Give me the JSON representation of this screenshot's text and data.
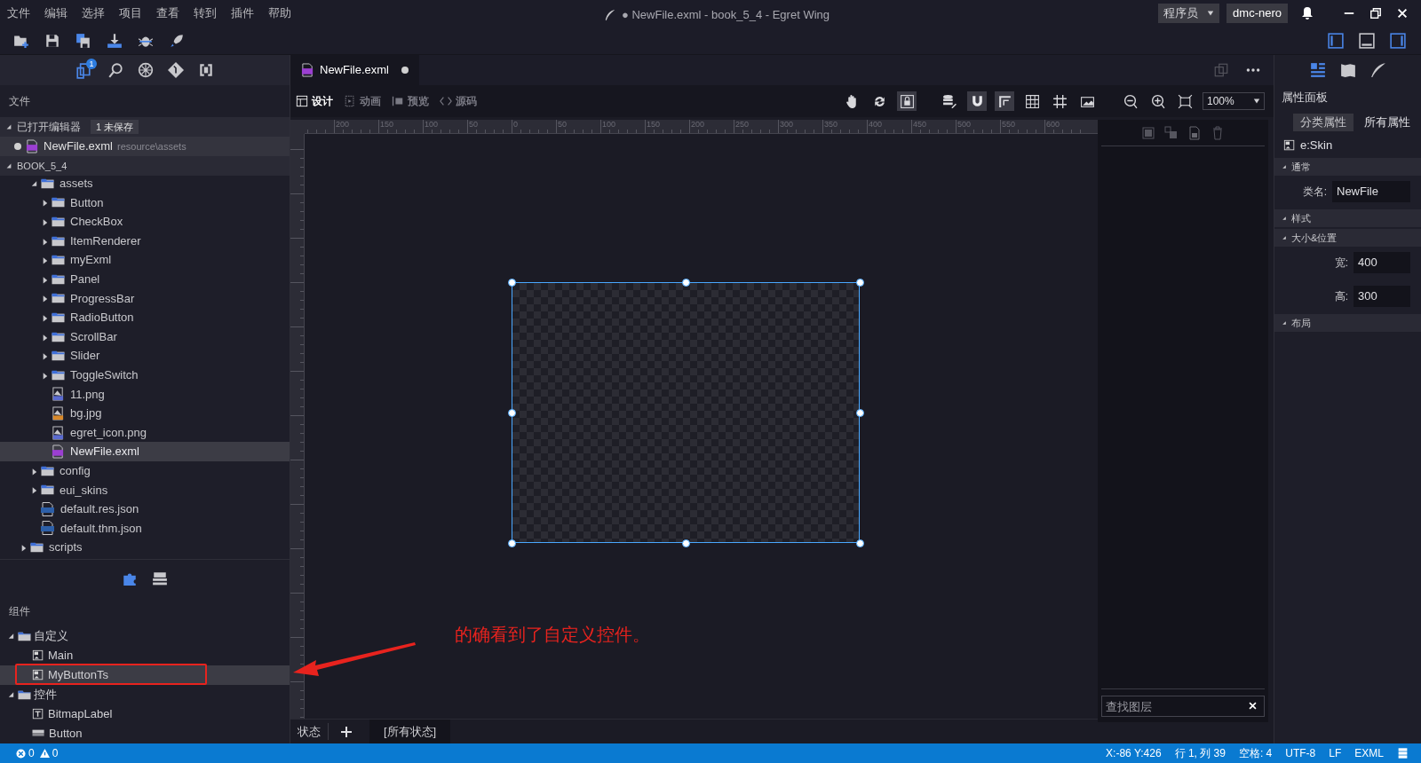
{
  "menu": [
    "文件",
    "编辑",
    "选择",
    "项目",
    "查看",
    "转到",
    "插件",
    "帮助"
  ],
  "window_title": "● NewFile.exml - book_5_4 - Egret Wing",
  "role_select": "程序员",
  "user": "dmc-nero",
  "sidebar": {
    "badge_count": "1",
    "header": "文件",
    "open_editors": {
      "label": "已打开编辑器",
      "badge": "1 未保存",
      "files": [
        {
          "name": "NewFile.exml",
          "path": "resource\\assets",
          "unsaved": true
        }
      ]
    },
    "project": {
      "label": "BOOK_5_4",
      "children": [
        {
          "children": [
            {
              "name": "assets",
              "kind": "folder",
              "expanded": true,
              "selected": false,
              "children": [
                {
                  "name": "Button",
                  "kind": "folder",
                  "expanded": false,
                  "selected": false
                },
                {
                  "name": "CheckBox",
                  "kind": "folder",
                  "expanded": false,
                  "selected": false
                },
                {
                  "name": "ItemRenderer",
                  "kind": "folder",
                  "expanded": false,
                  "selected": false
                },
                {
                  "name": "myExml",
                  "kind": "folder",
                  "expanded": false,
                  "selected": false
                },
                {
                  "name": "Panel",
                  "kind": "folder",
                  "expanded": false,
                  "selected": false
                },
                {
                  "name": "ProgressBar",
                  "kind": "folder",
                  "expanded": false,
                  "selected": false
                },
                {
                  "name": "RadioButton",
                  "kind": "folder",
                  "expanded": false,
                  "selected": false
                },
                {
                  "name": "ScrollBar",
                  "kind": "folder",
                  "expanded": false,
                  "selected": false
                },
                {
                  "name": "Slider",
                  "kind": "folder",
                  "expanded": false,
                  "selected": false
                },
                {
                  "name": "ToggleSwitch",
                  "kind": "folder",
                  "expanded": false,
                  "selected": false
                },
                {
                  "name": "11.png",
                  "kind": "png",
                  "selected": false
                },
                {
                  "name": "bg.jpg",
                  "kind": "jpg",
                  "selected": false
                },
                {
                  "name": "egret_icon.png",
                  "kind": "png",
                  "selected": false
                },
                {
                  "name": "NewFile.exml",
                  "kind": "exml",
                  "selected": true
                }
              ]
            },
            {
              "name": "config",
              "kind": "folder",
              "expanded": false,
              "selected": false
            },
            {
              "name": "eui_skins",
              "kind": "folder",
              "expanded": false,
              "selected": false
            },
            {
              "name": "default.res.json",
              "kind": "json",
              "selected": false
            },
            {
              "name": "default.thm.json",
              "kind": "json",
              "selected": false
            }
          ]
        },
        {
          "name": "scripts",
          "kind": "folder",
          "expanded": false,
          "selected": false
        }
      ]
    }
  },
  "components": {
    "header": "组件",
    "groups": [
      {
        "name": "自定义",
        "expanded": true,
        "children": [
          {
            "name": "Main",
            "kind": "skin",
            "selected": false
          },
          {
            "name": "MyButtonTs",
            "kind": "skin",
            "selected": true
          }
        ]
      },
      {
        "name": "控件",
        "expanded": true,
        "children": [
          {
            "name": "BitmapLabel",
            "kind": "label",
            "selected": false
          },
          {
            "name": "Button",
            "kind": "button",
            "selected": false
          }
        ]
      }
    ]
  },
  "editor": {
    "tab": {
      "label": "NewFile.exml",
      "unsaved": true
    },
    "modes": [
      {
        "label": "设计",
        "selected": true
      },
      {
        "label": "动画",
        "selected": false
      },
      {
        "label": "预览",
        "selected": false
      },
      {
        "label": "源码",
        "selected": false
      }
    ],
    "zoom": "100%",
    "ruler_labels": [
      "200",
      "150",
      "100",
      "50",
      "0",
      "50",
      "100",
      "150",
      "200",
      "250",
      "300",
      "350",
      "400",
      "450",
      "500",
      "550",
      "600"
    ],
    "states_label": "状态",
    "all_states": "[所有状态]"
  },
  "layers": {
    "search_placeholder": "查找图层"
  },
  "properties": {
    "title": "属性面板",
    "tabs": [
      {
        "label": "分类属性",
        "selected": true
      },
      {
        "label": "所有属性",
        "selected": false
      }
    ],
    "element": "e:Skin",
    "sections": [
      {
        "label": "通常",
        "fields": [
          {
            "label": "类名:",
            "value": "NewFile"
          }
        ]
      },
      {
        "label": "样式"
      },
      {
        "label": "大小&位置",
        "fields": [
          {
            "label": "宽:",
            "value": "400"
          },
          {
            "label": "高:",
            "value": "300"
          }
        ]
      },
      {
        "label": "布局"
      }
    ]
  },
  "status_bar": {
    "errors": "0",
    "warnings": "0",
    "items": [
      "X:-86 Y:426",
      "行 1, 列 39",
      "空格: 4",
      "UTF-8",
      "LF",
      "EXML"
    ]
  },
  "annotation": {
    "text": "的确看到了自定义控件。"
  }
}
